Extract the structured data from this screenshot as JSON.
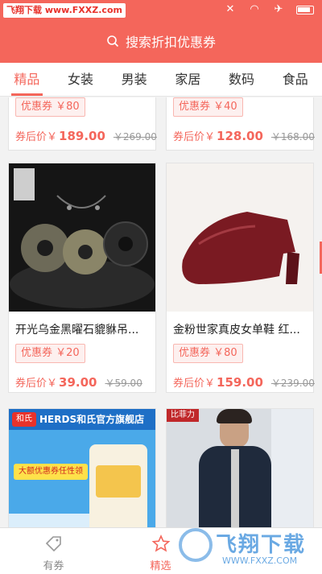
{
  "status": {
    "watermark": "飞翔下载 www.FXXZ.com"
  },
  "search": {
    "placeholder": "搜索折扣优惠券"
  },
  "tabs": [
    {
      "label": "精品",
      "active": true
    },
    {
      "label": "女装",
      "active": false
    },
    {
      "label": "男装",
      "active": false
    },
    {
      "label": "家居",
      "active": false
    },
    {
      "label": "数码",
      "active": false
    },
    {
      "label": "食品",
      "active": false
    }
  ],
  "products": [
    {
      "coupon": "优惠券 ￥80",
      "after_label": "券后价￥",
      "price": "189.00",
      "original": "￥269.00"
    },
    {
      "coupon": "优惠券 ￥40",
      "after_label": "券后价￥",
      "price": "128.00",
      "original": "￥168.00"
    },
    {
      "title": "开光乌金黑曜石貔貅吊...",
      "coupon": "优惠券 ￥20",
      "after_label": "券后价￥",
      "price": "39.00",
      "original": "￥59.00"
    },
    {
      "title": "金粉世家真皮女单鞋 红...",
      "coupon": "优惠券 ￥80",
      "after_label": "券后价￥",
      "price": "159.00",
      "original": "￥239.00"
    },
    {
      "banner": "HERDS和氏官方旗舰店",
      "badge": "和氏",
      "promo": "大额优惠券任性领"
    },
    {
      "badge": "比菲力"
    }
  ],
  "bottom_nav": [
    {
      "label": "有券",
      "icon": "tag-icon",
      "active": false
    },
    {
      "label": "精选",
      "icon": "star-icon",
      "active": true
    }
  ],
  "site_mark": {
    "title": "飞翔下载",
    "url": "WWW.FXXZ.COM"
  },
  "colors": {
    "accent": "#f4665b",
    "background": "#f2f2f2"
  }
}
